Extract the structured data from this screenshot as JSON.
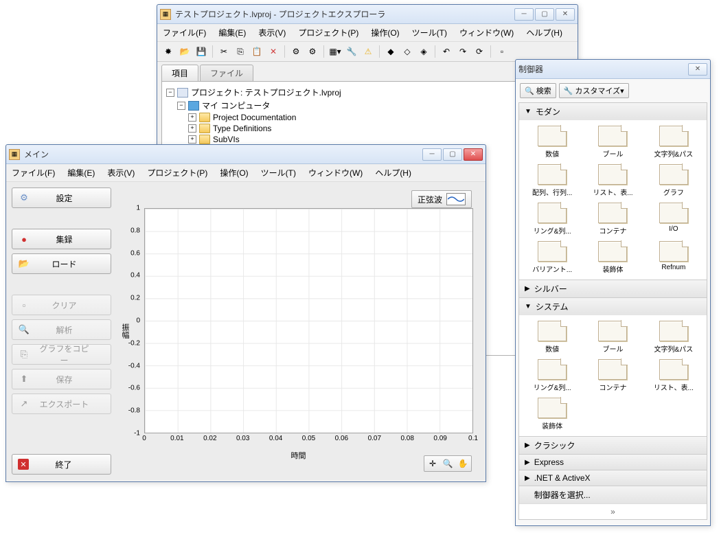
{
  "project_window": {
    "title": "テストプロジェクト.lvproj - プロジェクトエクスプローラ",
    "menu": [
      "ファイル(F)",
      "編集(E)",
      "表示(V)",
      "プロジェクト(P)",
      "操作(O)",
      "ツール(T)",
      "ウィンドウ(W)",
      "ヘルプ(H)"
    ],
    "tabs": {
      "items": "項目",
      "files": "ファイル"
    },
    "tree": {
      "root": "プロジェクト: テストプロジェクト.lvproj",
      "computer": "マイ コンピュータ",
      "children": [
        "Project Documentation",
        "Type Definitions",
        "SubVIs"
      ]
    }
  },
  "main_vi": {
    "title": "メイン",
    "menu": [
      "ファイル(F)",
      "編集(E)",
      "表示(V)",
      "プロジェクト(P)",
      "操作(O)",
      "ツール(T)",
      "ウィンドウ(W)",
      "ヘルプ(H)"
    ],
    "buttons": {
      "settings": "設定",
      "acquire": "集録",
      "load": "ロード",
      "clear": "クリア",
      "analyze": "解析",
      "copygraph": "グラフをコピー",
      "save": "保存",
      "export": "エクスポート",
      "exit": "終了"
    },
    "legend": "正弦波"
  },
  "chart_data": {
    "type": "line",
    "title": "",
    "xlabel": "時間",
    "ylabel": "振幅",
    "x_ticks": [
      "0",
      "0.01",
      "0.02",
      "0.03",
      "0.04",
      "0.05",
      "0.06",
      "0.07",
      "0.08",
      "0.09",
      "0.1"
    ],
    "y_ticks": [
      "1",
      "0.8",
      "0.6",
      "0.4",
      "0.2",
      "0",
      "-0.2",
      "-0.4",
      "-0.6",
      "-0.8",
      "-1"
    ],
    "xlim": [
      0,
      0.1
    ],
    "ylim": [
      -1,
      1
    ],
    "series": [
      {
        "name": "正弦波",
        "x": [],
        "values": []
      }
    ]
  },
  "palette": {
    "title": "制御器",
    "search": "検索",
    "customize": "カスタマイズ▾",
    "sections": {
      "modern": "モダン",
      "silver": "シルバー",
      "system": "システム",
      "classic": "クラシック",
      "express": "Express",
      "netactivex": ".NET & ActiveX",
      "select": "制御器を選択..."
    },
    "modern_items": [
      "数値",
      "ブール",
      "文字列&パス",
      "配列、行列...",
      "リスト、表...",
      "グラフ",
      "リング&列...",
      "コンテナ",
      "I/O",
      "バリアント...",
      "装飾体",
      "Refnum"
    ],
    "system_items": [
      "数値",
      "ブール",
      "文字列&パス",
      "リング&列...",
      "コンテナ",
      "リスト、表...",
      "装飾体"
    ],
    "more": "»"
  }
}
